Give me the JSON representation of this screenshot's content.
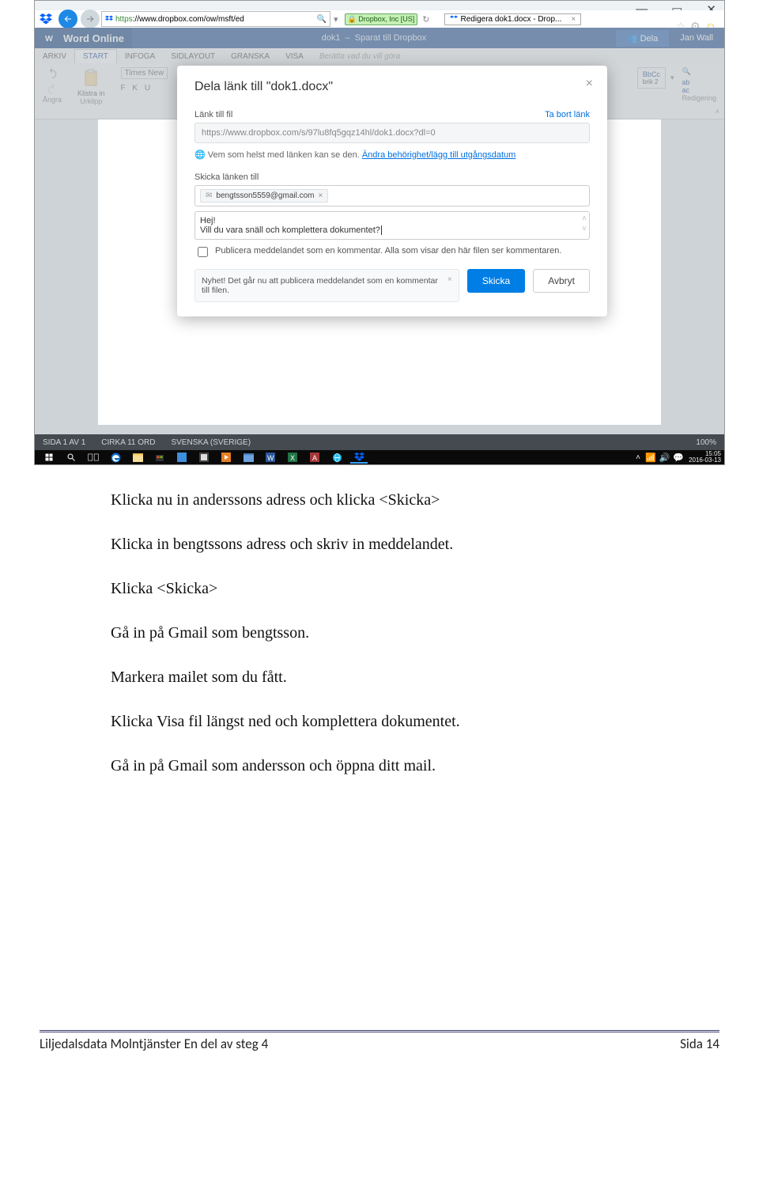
{
  "window_controls": {
    "min": "—",
    "max": "▭",
    "close": "✕"
  },
  "browser": {
    "url_display": "https://www.dropbox.com/ow/msft/ed",
    "lock_label": "Dropbox, Inc [US]",
    "tab_title": "Redigera dok1.docx - Drop...",
    "tab_close": "×"
  },
  "word": {
    "app_name": "Word Online",
    "doc_name": "dok1",
    "save_status": "Sparat till Dropbox",
    "share": "Dela",
    "user": "Jan Wall",
    "tabs": {
      "arkiv": "ARKIV",
      "start": "START",
      "infoga": "INFOGA",
      "sidlayout": "SIDLAYOUT",
      "granska": "GRANSKA",
      "visa": "VISA",
      "berata": "Berätta vad du vill göra"
    },
    "ribbon": {
      "undo_group": "Ångra",
      "paste_label": "Klistra in",
      "clipboard_group": "Urklipp",
      "font_name": "Times New",
      "format_letters": "F  K  U",
      "style_box": "BbCc",
      "style_name": "brik 2",
      "edit_group": "Redigering"
    }
  },
  "status_bar": {
    "page": "SIDA 1 AV 1",
    "words": "CIRKA 11 ORD",
    "lang": "SVENSKA (SVERIGE)",
    "zoom": "100%"
  },
  "taskbar": {
    "time": "15:05",
    "date": "2016-03-13"
  },
  "modal": {
    "title": "Dela länk till \"dok1.docx\"",
    "link_label": "Länk till fil",
    "remove_link": "Ta bort länk",
    "url": "https://www.dropbox.com/s/97lu8fq5gqz14hl/dok1.docx?dl=0",
    "perm_text": "Vem som helst med länken kan se den.",
    "perm_link": "Ändra behörighet/lägg till utgångsdatum",
    "send_label": "Skicka länken till",
    "recipient": "bengtsson5559@gmail.com",
    "chip_x": "×",
    "msg_line1": "Hej!",
    "msg_line2": "Vill du vara snäll och komplettera dokumentet?",
    "publish_label": "Publicera meddelandet som en kommentar. Alla som visar den här filen ser kommentaren.",
    "tip": "Nyhet! Det går nu att publicera meddelandet som en kommentar till filen.",
    "tip_close": "×",
    "send_btn": "Skicka",
    "cancel_btn": "Avbryt",
    "modal_close": "×"
  },
  "instructions": {
    "p1": "Klicka nu in anderssons adress och klicka <Skicka>",
    "p2": "Klicka in bengtssons adress och skriv in meddelandet.",
    "p3": "Klicka <Skicka>",
    "p4": "Gå in på Gmail som bengtsson.",
    "p5": "Markera mailet som du fått.",
    "p6": "Klicka Visa fil längst ned och komplettera dokumentet.",
    "p7": "Gå in på Gmail som andersson och öppna ditt mail."
  },
  "footer": {
    "left": "Liljedalsdata Molntjänster En del av steg 4",
    "right": "Sida 14"
  }
}
